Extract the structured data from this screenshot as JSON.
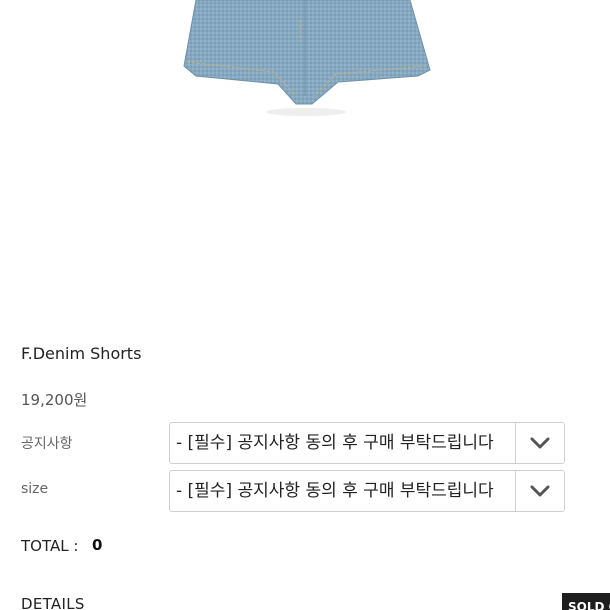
{
  "product": {
    "name": "F.Denim Shorts",
    "price": "19,200원",
    "image_icon": "denim-shorts-image"
  },
  "options": [
    {
      "label": "공지사항",
      "selected": "- [필수] 공지사항 동의 후 구매 부탁드립니다"
    },
    {
      "label": "size",
      "selected": "- [필수] 공지사항 동의 후 구매 부탁드립니다"
    }
  ],
  "total": {
    "label": "TOTAL :",
    "value": "0"
  },
  "details_label": "DETAILS",
  "sold_button": {
    "label": "SOLD OUT",
    "color": "#1e1e1e"
  },
  "colors": {
    "denim": "#7fa6bf",
    "border": "#cfcfcf"
  }
}
